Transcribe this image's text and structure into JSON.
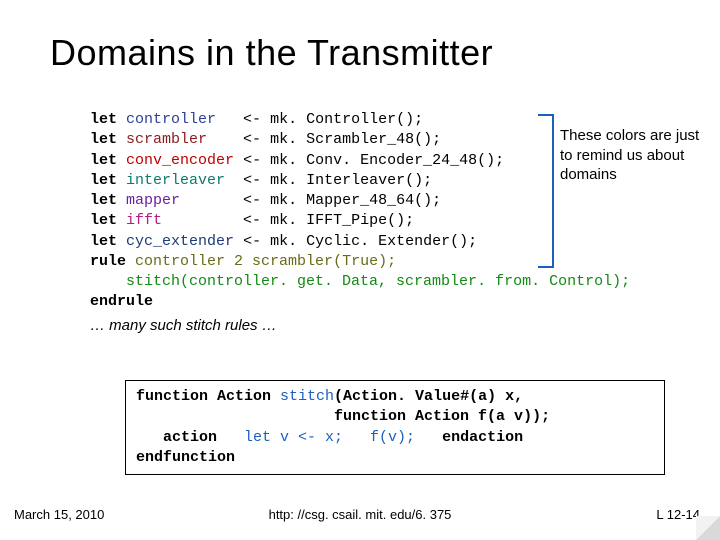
{
  "title": "Domains in the Transmitter",
  "code": {
    "l1": {
      "kw": "let",
      "name": "controller",
      "rhs": "mk. Controller();"
    },
    "l2": {
      "kw": "let",
      "name": "scrambler",
      "rhs": "mk. Scrambler_48();"
    },
    "l3": {
      "kw": "let",
      "name": "conv_encoder",
      "rhs": "mk. Conv. Encoder_24_48();"
    },
    "l4": {
      "kw": "let",
      "name": "interleaver",
      "rhs": "mk. Interleaver();"
    },
    "l5": {
      "kw": "let",
      "name": "mapper",
      "rhs": "mk. Mapper_48_64();"
    },
    "l6": {
      "kw": "let",
      "name": "ifft",
      "rhs": "mk. IFFT_Pipe();"
    },
    "l7": {
      "kw": "let",
      "name": "cyc_extender",
      "rhs": "mk. Cyclic. Extender();"
    },
    "rule_kw": "rule",
    "rule_name": "controller 2 scrambler(True);",
    "stitch_call": "    stitch(controller. get. Data, scrambler. from. Control);",
    "endrule": "endrule",
    "trail": "… many such stitch rules …"
  },
  "annotation": "These colors are just to remind us about domains",
  "func": {
    "sig1a": "function Action ",
    "sig1b": "stitch",
    "sig1c": "(Action. Value#(a) x,",
    "sig2": "                      function Action f(a v));",
    "body1a": "   action   ",
    "body1b": "let v <- x;   f(v);",
    "body1c": "   endaction",
    "end": "endfunction"
  },
  "footer": {
    "left": "March 15, 2010",
    "center": "http: //csg. csail. mit. edu/6. 375",
    "right": "L 12-14"
  }
}
